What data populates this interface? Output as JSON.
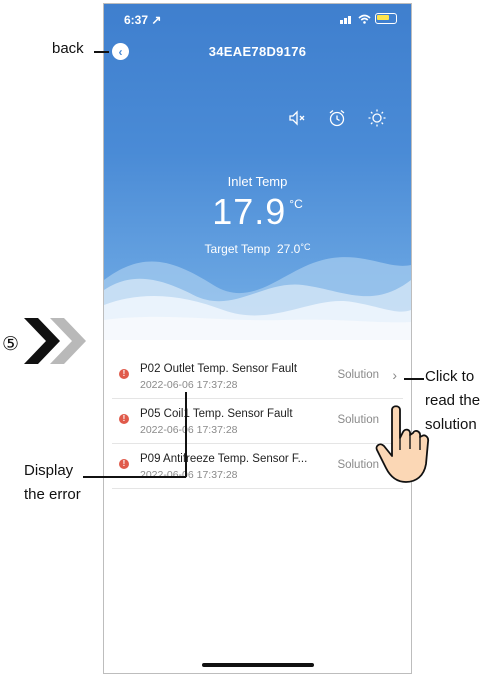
{
  "status_bar": {
    "time": "6:37 ↗",
    "signal": "▪▮▮",
    "wifi": "◠"
  },
  "header": {
    "title": "34EAE78D9176",
    "back_glyph": "‹"
  },
  "reading": {
    "label": "Inlet Temp",
    "value": "17.9",
    "unit": "°C",
    "target_label": "Target Temp",
    "target_value": "27.0",
    "target_unit": "°C"
  },
  "icons": [
    "mute-icon",
    "alarm-clock-icon",
    "brightness-icon"
  ],
  "errors": [
    {
      "code": "P02 Outlet Temp. Sensor Fault",
      "date": "2022-06-06 17:37:28",
      "action": "Solution"
    },
    {
      "code": "P05 Coil1 Temp. Sensor Fault",
      "date": "2022-06-06 17:37:28",
      "action": "Solution"
    },
    {
      "code": "P09 Antifreeze Temp. Sensor F...",
      "date": "2022-06-06 17:37:28",
      "action": "Solution"
    }
  ],
  "annotations": {
    "back": "back",
    "step": "⑤",
    "click_line1": "Click to",
    "click_line2": "read the",
    "click_line3": "solution",
    "display_line1": "Display",
    "display_line2": "the error"
  },
  "colors": {
    "hero_top": "#3f7fce",
    "hero_bottom": "#74aee6",
    "error": "#e05a4a"
  }
}
